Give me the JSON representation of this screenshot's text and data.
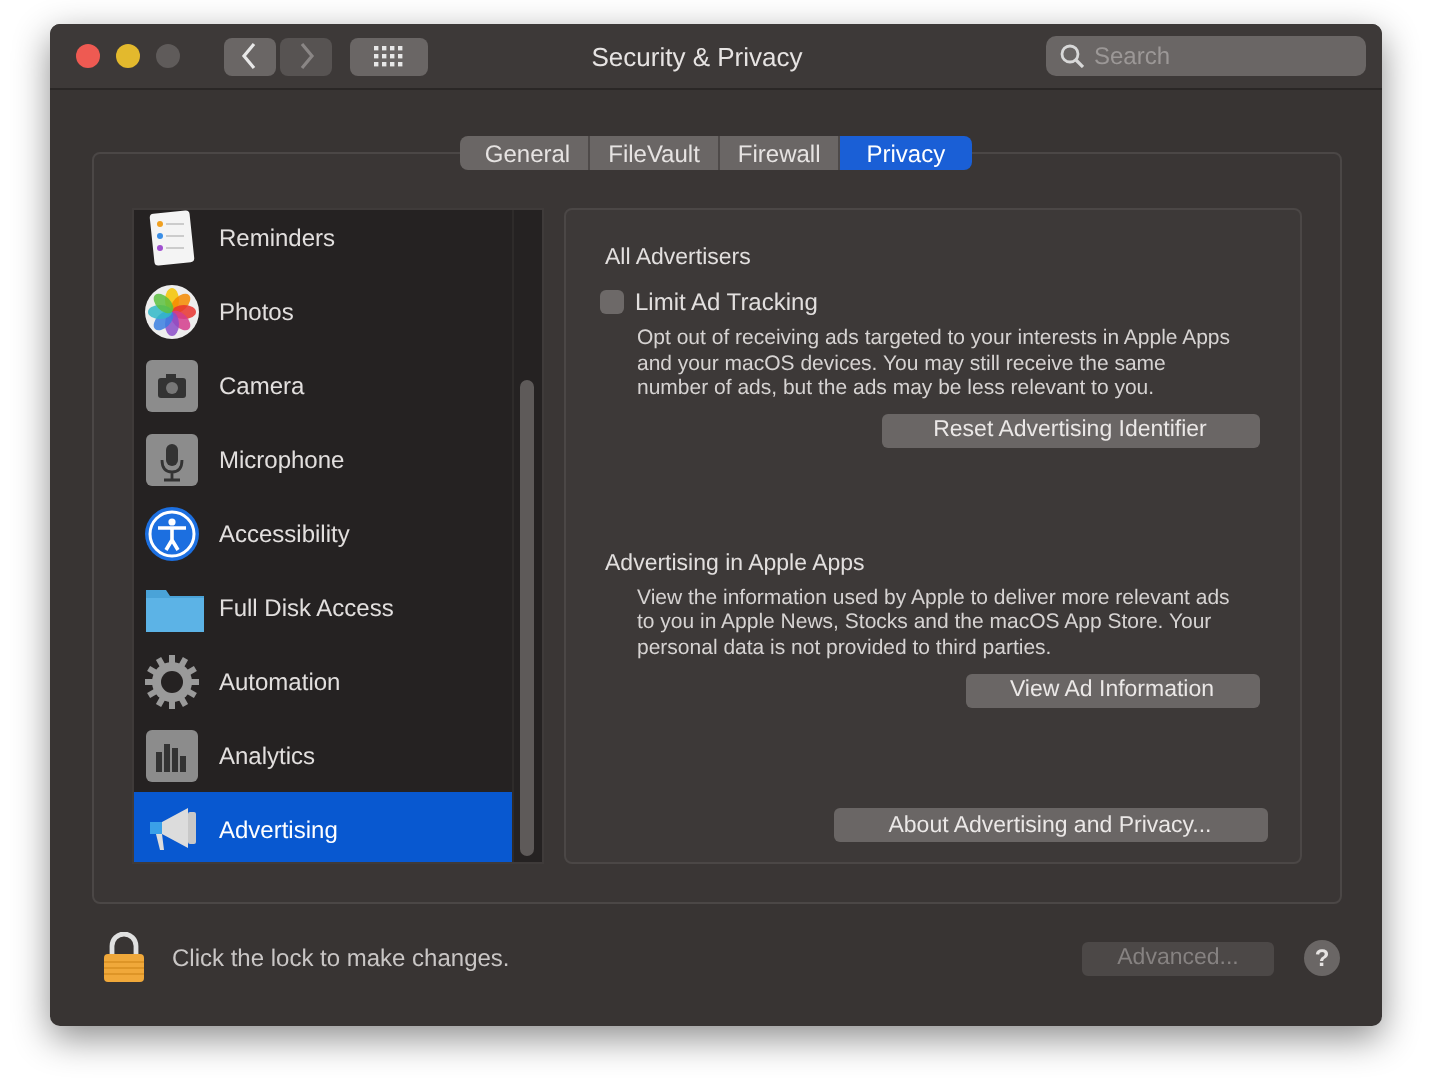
{
  "window": {
    "title": "Security & Privacy",
    "back_enabled": true,
    "forward_enabled": false
  },
  "search": {
    "placeholder": "Search"
  },
  "tabs": [
    {
      "label": "General",
      "selected": false
    },
    {
      "label": "FileVault",
      "selected": false
    },
    {
      "label": "Firewall",
      "selected": false
    },
    {
      "label": "Privacy",
      "selected": true
    }
  ],
  "sidebar": {
    "items": [
      {
        "label": "Reminders",
        "kind": "reminders",
        "selected": false
      },
      {
        "label": "Photos",
        "kind": "photos",
        "selected": false
      },
      {
        "label": "Camera",
        "kind": "camera",
        "selected": false
      },
      {
        "label": "Microphone",
        "kind": "microphone",
        "selected": false
      },
      {
        "label": "Accessibility",
        "kind": "accessibility",
        "selected": false
      },
      {
        "label": "Full Disk Access",
        "kind": "folder",
        "selected": false
      },
      {
        "label": "Automation",
        "kind": "gear",
        "selected": false
      },
      {
        "label": "Analytics",
        "kind": "analytics",
        "selected": false
      },
      {
        "label": "Advertising",
        "kind": "megaphone",
        "selected": true
      }
    ]
  },
  "detail": {
    "sections": [
      {
        "heading": "All Advertisers",
        "checkbox": {
          "label": "Limit Ad Tracking",
          "checked": false
        },
        "description": "Opt out of receiving ads targeted to your interests in Apple Apps and your macOS devices. You may still receive the same number of ads, but the ads may be less relevant to you.",
        "button": "Reset Advertising Identifier"
      },
      {
        "heading": "Advertising in Apple Apps",
        "description": "View the information used by Apple to deliver more relevant ads to you in Apple News, Stocks and the macOS App Store. Your personal data is not provided to third parties.",
        "button": "View Ad Information"
      }
    ],
    "footer_button": "About Advertising and Privacy..."
  },
  "status": {
    "text": "Click the lock to make changes.",
    "advanced": {
      "label": "Advanced...",
      "disabled": true
    },
    "help": "?"
  }
}
